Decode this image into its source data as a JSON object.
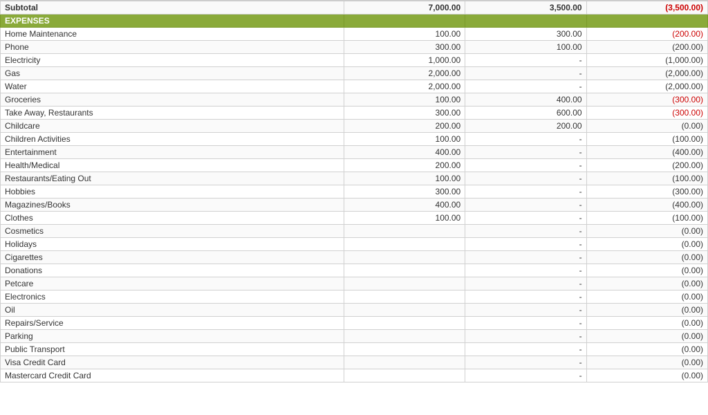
{
  "subtotal": {
    "label": "Subtotal",
    "budget": "7,000.00",
    "actual": "3,500.00",
    "diff": "(3,500.00)"
  },
  "expenses_header": "EXPENSES",
  "rows": [
    {
      "label": "Home Maintenance",
      "budget": "100.00",
      "actual": "300.00",
      "diff": "(200.00)",
      "diff_neg": true
    },
    {
      "label": "Phone",
      "budget": "300.00",
      "actual": "100.00",
      "diff": "(200.00)",
      "diff_neg": false
    },
    {
      "label": "Electricity",
      "budget": "1,000.00",
      "actual": "-",
      "diff": "(1,000.00)",
      "diff_neg": false
    },
    {
      "label": "Gas",
      "budget": "2,000.00",
      "actual": "-",
      "diff": "(2,000.00)",
      "diff_neg": false
    },
    {
      "label": "Water",
      "budget": "2,000.00",
      "actual": "-",
      "diff": "(2,000.00)",
      "diff_neg": false
    },
    {
      "label": "Groceries",
      "budget": "100.00",
      "actual": "400.00",
      "diff": "(300.00)",
      "diff_neg": true
    },
    {
      "label": "Take Away, Restaurants",
      "budget": "300.00",
      "actual": "600.00",
      "diff": "(300.00)",
      "diff_neg": true
    },
    {
      "label": "Childcare",
      "budget": "200.00",
      "actual": "200.00",
      "diff": "(0.00)",
      "diff_neg": false
    },
    {
      "label": "Children Activities",
      "budget": "100.00",
      "actual": "-",
      "diff": "(100.00)",
      "diff_neg": false
    },
    {
      "label": "Entertainment",
      "budget": "400.00",
      "actual": "-",
      "diff": "(400.00)",
      "diff_neg": false
    },
    {
      "label": "Health/Medical",
      "budget": "200.00",
      "actual": "-",
      "diff": "(200.00)",
      "diff_neg": false
    },
    {
      "label": "Restaurants/Eating Out",
      "budget": "100.00",
      "actual": "-",
      "diff": "(100.00)",
      "diff_neg": false
    },
    {
      "label": "Hobbies",
      "budget": "300.00",
      "actual": "-",
      "diff": "(300.00)",
      "diff_neg": false
    },
    {
      "label": "Magazines/Books",
      "budget": "400.00",
      "actual": "-",
      "diff": "(400.00)",
      "diff_neg": false
    },
    {
      "label": "Clothes",
      "budget": "100.00",
      "actual": "-",
      "diff": "(100.00)",
      "diff_neg": false
    },
    {
      "label": "Cosmetics",
      "budget": "",
      "actual": "-",
      "diff": "(0.00)",
      "diff_neg": false
    },
    {
      "label": "Holidays",
      "budget": "",
      "actual": "-",
      "diff": "(0.00)",
      "diff_neg": false
    },
    {
      "label": "Cigarettes",
      "budget": "",
      "actual": "-",
      "diff": "(0.00)",
      "diff_neg": false
    },
    {
      "label": "Donations",
      "budget": "",
      "actual": "-",
      "diff": "(0.00)",
      "diff_neg": false
    },
    {
      "label": "Petcare",
      "budget": "",
      "actual": "-",
      "diff": "(0.00)",
      "diff_neg": false
    },
    {
      "label": "Electronics",
      "budget": "",
      "actual": "-",
      "diff": "(0.00)",
      "diff_neg": false
    },
    {
      "label": "Oil",
      "budget": "",
      "actual": "-",
      "diff": "(0.00)",
      "diff_neg": false
    },
    {
      "label": "Repairs/Service",
      "budget": "",
      "actual": "-",
      "diff": "(0.00)",
      "diff_neg": false
    },
    {
      "label": "Parking",
      "budget": "",
      "actual": "-",
      "diff": "(0.00)",
      "diff_neg": false
    },
    {
      "label": "Public Transport",
      "budget": "",
      "actual": "-",
      "diff": "(0.00)",
      "diff_neg": false
    },
    {
      "label": "Visa Credit Card",
      "budget": "",
      "actual": "-",
      "diff": "(0.00)",
      "diff_neg": false
    },
    {
      "label": "Mastercard Credit Card",
      "budget": "",
      "actual": "-",
      "diff": "(0.00)",
      "diff_neg": false
    }
  ]
}
